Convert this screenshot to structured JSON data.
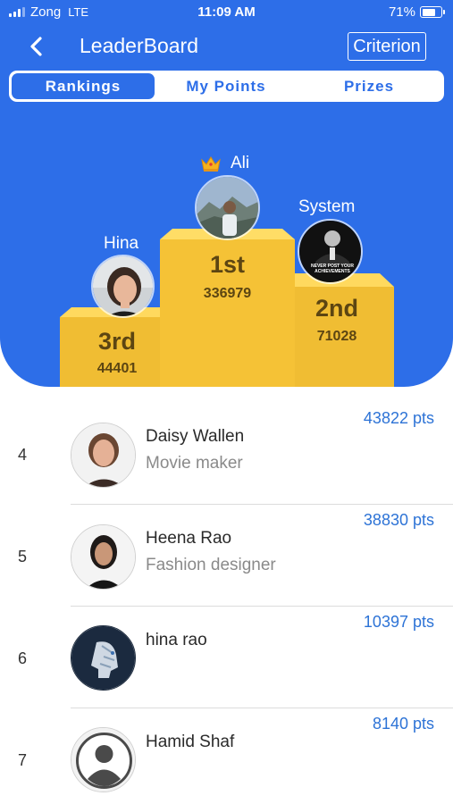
{
  "status_bar": {
    "carrier": "Zong",
    "network": "LTE",
    "time": "11:09 AM",
    "battery": "71%",
    "battery_level": 0.71
  },
  "header": {
    "title": "LeaderBoard",
    "criterion_label": "Criterion"
  },
  "tabs": [
    {
      "label": "Rankings",
      "active": true
    },
    {
      "label": "My Points",
      "active": false
    },
    {
      "label": "Prizes",
      "active": false
    }
  ],
  "podium": {
    "first": {
      "name": "Ali",
      "place": "1st",
      "points": "336979"
    },
    "second": {
      "name": "System",
      "place": "2nd",
      "points": "71028",
      "poster_text": "NEVER POST YOUR ACHIEVEMENTS"
    },
    "third": {
      "name": "Hina",
      "place": "3rd",
      "points": "44401"
    }
  },
  "rankings": [
    {
      "rank": "4",
      "name": "Daisy Wallen",
      "subtitle": "Movie maker",
      "points": "43822 pts"
    },
    {
      "rank": "5",
      "name": "Heena Rao",
      "subtitle": "Fashion designer",
      "points": "38830 pts"
    },
    {
      "rank": "6",
      "name": "hina rao",
      "subtitle": "",
      "points": "10397 pts"
    },
    {
      "rank": "7",
      "name": "Hamid Shaf",
      "subtitle": "",
      "points": "8140 pts"
    }
  ],
  "colors": {
    "primary": "#2d6ee8",
    "podium_gold": "#f3c33a",
    "points_blue": "#2d73d6"
  }
}
